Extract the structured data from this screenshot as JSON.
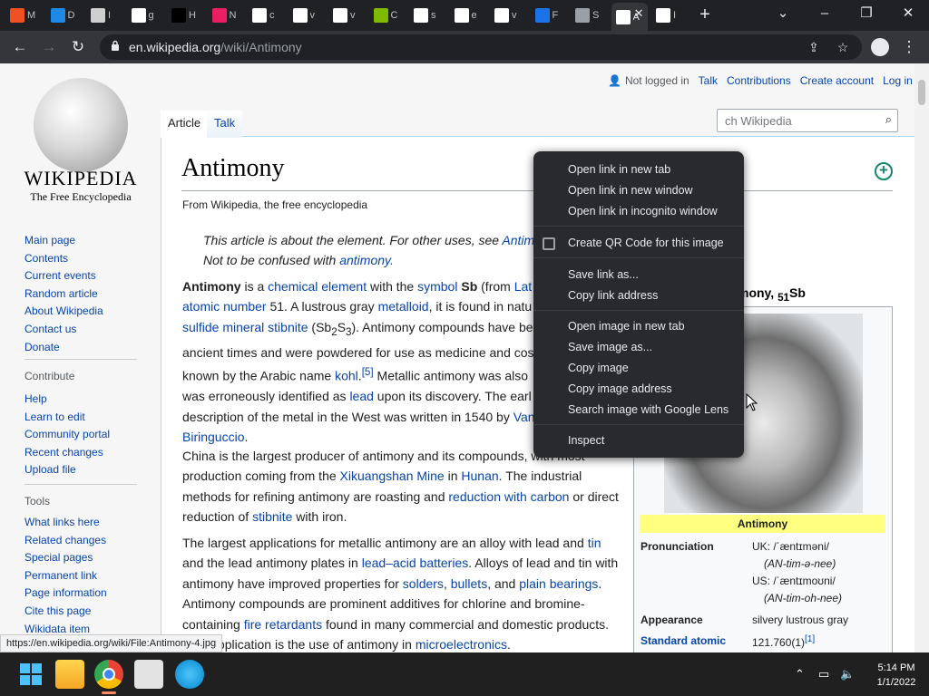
{
  "browser": {
    "tabs": [
      {
        "favicon": "microsoft-icon",
        "title": "M",
        "color": "#f25022"
      },
      {
        "favicon": "chart-icon",
        "title": "D",
        "color": "#1e88e5"
      },
      {
        "favicon": "sword-icon",
        "title": "I",
        "color": "#cfcfcf"
      },
      {
        "favicon": "google-icon",
        "title": "g",
        "color": "#ffffff"
      },
      {
        "favicon": "bb-icon",
        "title": "H",
        "color": "#000000"
      },
      {
        "favicon": "k-icon",
        "title": "N",
        "color": "#e91e63"
      },
      {
        "favicon": "google-icon",
        "title": "c",
        "color": "#ffffff"
      },
      {
        "favicon": "google-icon",
        "title": "v",
        "color": "#ffffff"
      },
      {
        "favicon": "google-icon",
        "title": "v",
        "color": "#ffffff"
      },
      {
        "favicon": "microsoft-icon",
        "title": "C",
        "color": "#7fba00"
      },
      {
        "favicon": "google-icon",
        "title": "s",
        "color": "#ffffff"
      },
      {
        "favicon": "google-icon",
        "title": "e",
        "color": "#ffffff"
      },
      {
        "favicon": "google-icon",
        "title": "v",
        "color": "#ffffff"
      },
      {
        "favicon": "edge-icon",
        "title": "F",
        "color": "#1a73e8"
      },
      {
        "favicon": "globe-icon",
        "title": "S",
        "color": "#9aa0a6"
      },
      {
        "favicon": "wikipedia-icon",
        "title": "A",
        "color": "#ffffff",
        "active": true
      },
      {
        "favicon": "wikipedia-icon",
        "title": "I",
        "color": "#ffffff"
      }
    ],
    "url_host": "en.wikipedia.org",
    "url_path": "/wiki/Antimony"
  },
  "wiki": {
    "logo_word": "WIKIPEDIA",
    "logo_tagline": "The Free Encyclopedia",
    "nav_main": [
      "Main page",
      "Contents",
      "Current events",
      "Random article",
      "About Wikipedia",
      "Contact us",
      "Donate"
    ],
    "contribute_heading": "Contribute",
    "nav_contribute": [
      "Help",
      "Learn to edit",
      "Community portal",
      "Recent changes",
      "Upload file"
    ],
    "tools_heading": "Tools",
    "nav_tools": [
      "What links here",
      "Related changes",
      "Special pages",
      "Permanent link",
      "Page information",
      "Cite this page",
      "Wikidata item"
    ],
    "user_tools": {
      "not_logged": "Not logged in",
      "talk": "Talk",
      "contributions": "Contributions",
      "create": "Create account",
      "login": "Log in"
    },
    "tab_article": "Article",
    "tab_talk": "Talk",
    "search_placeholder": "ch Wikipedia",
    "title": "Antimony",
    "subtitle": "From Wikipedia, the free encyclopedia",
    "hatnote1_text": "This article is about the element. For other uses, see ",
    "hatnote1_link": "Antim",
    "hatnote2_text": "Not to be confused with ",
    "hatnote2_link": "antimony."
  },
  "infobox": {
    "title": "mony, ",
    "title_sub": "51",
    "title_end": "Sb",
    "caption": "Antimony",
    "pronunciation_label": "Pronunciation",
    "pron_uk": "UK: /ˈæntɪməni/",
    "pron_uk2": "(AN-tim-ə-nee)",
    "pron_us": "US: /ˈæntɪmoʊni/",
    "pron_us2": "(AN-tim-oh-nee)",
    "appearance_label": "Appearance",
    "appearance_value": "silvery lustrous gray",
    "weight_label": "Standard atomic",
    "weight_value": "121.760(1)",
    "weight_ref": "[1]"
  },
  "context_menu": {
    "open_new_tab": "Open link in new tab",
    "open_new_window": "Open link in new window",
    "open_incognito": "Open link in incognito window",
    "qr": "Create QR Code for this image",
    "save_link": "Save link as...",
    "copy_link": "Copy link address",
    "open_image": "Open image in new tab",
    "save_image": "Save image as...",
    "copy_image": "Copy image",
    "copy_image_address": "Copy image address",
    "lens": "Search image with Google Lens",
    "inspect": "Inspect"
  },
  "status_url": "https://en.wikipedia.org/wiki/File:Antimony-4.jpg",
  "taskbar": {
    "time": "5:14 PM",
    "date": "1/1/2022"
  }
}
